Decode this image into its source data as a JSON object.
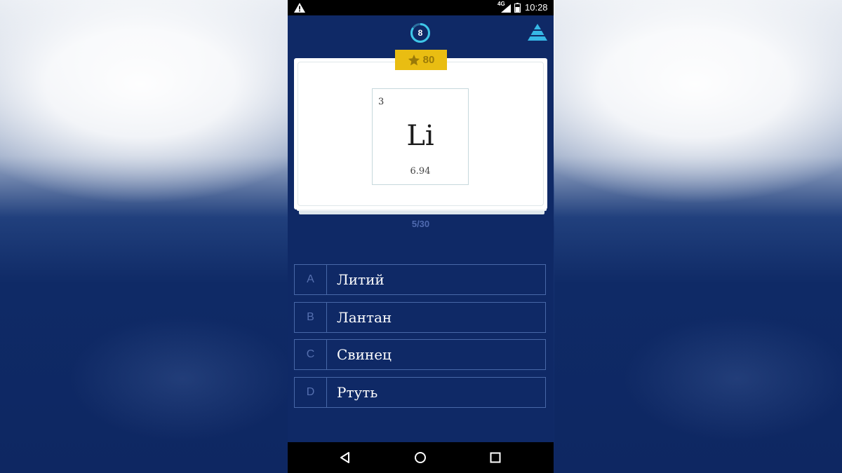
{
  "status_bar": {
    "network": "4G",
    "time": "10:28",
    "icons": [
      "warning-icon",
      "signal-icon",
      "battery-icon"
    ]
  },
  "header": {
    "timer_value": "8",
    "timer_icon": "countdown-ring-icon",
    "menu_icon": "pyramid-icon"
  },
  "score": {
    "value": "80",
    "icon": "star-icon"
  },
  "element": {
    "number": "3",
    "symbol": "Li",
    "mass": "6.94"
  },
  "progress": "5/30",
  "answers": [
    {
      "letter": "A",
      "text": "Литий"
    },
    {
      "letter": "B",
      "text": "Лантан"
    },
    {
      "letter": "C",
      "text": "Свинец"
    },
    {
      "letter": "D",
      "text": "Ртуть"
    }
  ],
  "nav_bar": {
    "icons": [
      "back-icon",
      "home-icon",
      "recent-apps-icon"
    ]
  },
  "colors": {
    "background": "#0f2966",
    "accent_badge": "#e9bd12",
    "answer_border": "#4868a8",
    "timer_ring": "#3ec7e8",
    "pyramid": "#36b8e6"
  }
}
